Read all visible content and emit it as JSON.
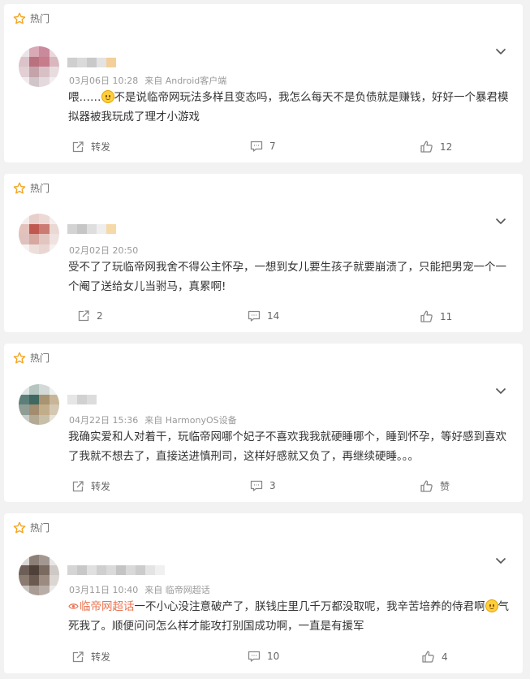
{
  "hot_label": "热门",
  "comments": [
    {
      "date": "03月06日 10:28",
      "source": "来自 Android客户端",
      "text_a": "喂……",
      "text_b": "不是说临帝网玩法多样且变态吗，我怎么每天不是负债就是赚钱，好好一个暴君模拟器被我玩成了理才小游戏",
      "repost": "转发",
      "comment_count": "7",
      "like_count": "12"
    },
    {
      "date": "02月02日 20:50",
      "source": "",
      "text": "受不了了玩临帝网我舍不得公主怀孕，一想到女儿要生孩子就要崩溃了，只能把男宠一个一个阉了送给女儿当驸马，真累啊!",
      "repost": "2",
      "comment_count": "14",
      "like_count": "11"
    },
    {
      "date": "04月22日 15:36",
      "source": "来自 HarmonyOS设备",
      "text": "我确实爱和人对着干，玩临帝网哪个妃子不喜欢我我就硬睡哪个，睡到怀孕，等好感到喜欢了我就不想去了，直接送进慎刑司，这样好感就又负了，再继续硬睡。。。",
      "repost": "转发",
      "comment_count": "3",
      "like_count": "赞"
    },
    {
      "date": "03月11日 10:40",
      "source": "来自 临帝网超话",
      "topic": "临帝网超话",
      "text_a": "一不小心没注意破产了，朕钱庄里几千万都没取呢，我辛苦培养的侍君啊",
      "text_b": "气死我了。顺便问问怎么样才能攻打别国成功啊，一直是有援军",
      "repost": "转发",
      "comment_count": "10",
      "like_count": "4"
    }
  ],
  "colors": {
    "star": "#f5a623",
    "link": "#eb7350",
    "icon": "#888888"
  },
  "icons": {
    "hot": "star-outline-icon",
    "expand": "chevron-down-icon",
    "repost": "share-icon",
    "comment": "comment-bubble-icon",
    "like": "thumbs-up-icon"
  }
}
